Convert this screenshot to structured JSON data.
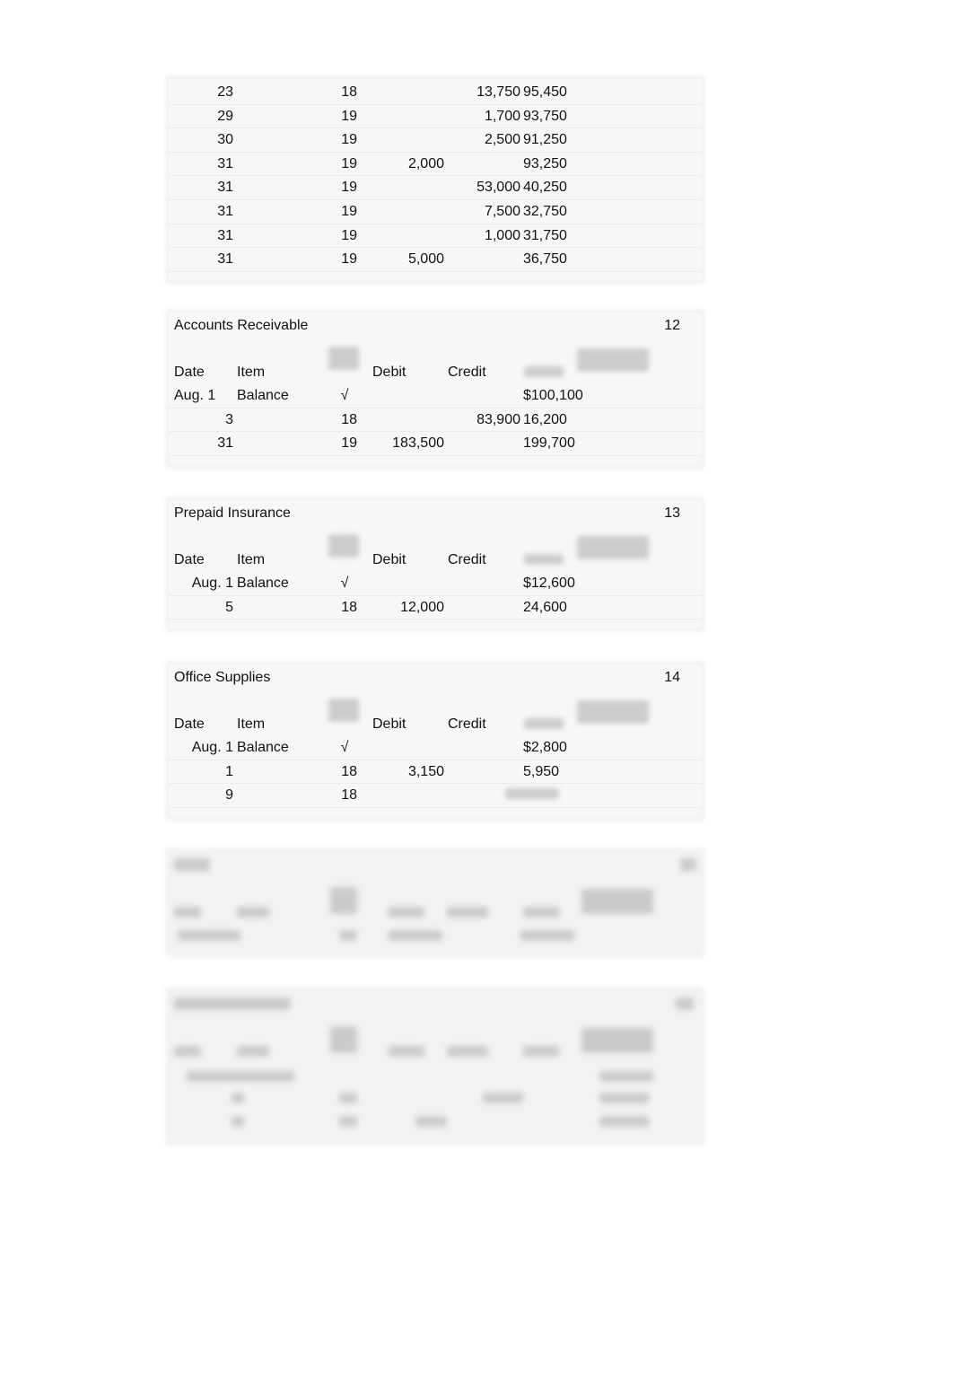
{
  "columns": {
    "date": "Date",
    "item": "Item",
    "debit": "Debit",
    "credit": "Credit"
  },
  "ledgers": [
    {
      "title": "",
      "number": "",
      "rows": [
        {
          "date": "23",
          "item": "",
          "ref": "18",
          "debit": "",
          "credit": "13,750",
          "balance": "95,450"
        },
        {
          "date": "29",
          "item": "",
          "ref": "19",
          "debit": "",
          "credit": "1,700",
          "balance": "93,750"
        },
        {
          "date": "30",
          "item": "",
          "ref": "19",
          "debit": "",
          "credit": "2,500",
          "balance": "91,250"
        },
        {
          "date": "31",
          "item": "",
          "ref": "19",
          "debit": "2,000",
          "credit": "",
          "balance": "93,250"
        },
        {
          "date": "31",
          "item": "",
          "ref": "19",
          "debit": "",
          "credit": "53,000",
          "balance": "40,250"
        },
        {
          "date": "31",
          "item": "",
          "ref": "19",
          "debit": "",
          "credit": "7,500",
          "balance": "32,750"
        },
        {
          "date": "31",
          "item": "",
          "ref": "19",
          "debit": "",
          "credit": "1,000",
          "balance": "31,750"
        },
        {
          "date": "31",
          "item": "",
          "ref": "19",
          "debit": "5,000",
          "credit": "",
          "balance": "36,750"
        }
      ]
    },
    {
      "title": "Accounts Receivable",
      "number": "12",
      "rows": [
        {
          "date": "Aug. 1",
          "item": "Balance",
          "ref": "√",
          "debit": "",
          "credit": "",
          "balance": "$100,100"
        },
        {
          "date": "3",
          "item": "",
          "ref": "18",
          "debit": "",
          "credit": "83,900",
          "balance": "16,200"
        },
        {
          "date": "31",
          "item": "",
          "ref": "19",
          "debit": "183,500",
          "credit": "",
          "balance": "199,700"
        }
      ]
    },
    {
      "title": "Prepaid Insurance",
      "number": "13",
      "rows": [
        {
          "date": "Aug. 1",
          "item": "Balance",
          "ref": "√",
          "debit": "",
          "credit": "",
          "balance": "$12,600"
        },
        {
          "date": "5",
          "item": "",
          "ref": "18",
          "debit": "12,000",
          "credit": "",
          "balance": "24,600"
        }
      ]
    },
    {
      "title": "Office Supplies",
      "number": "14",
      "rows": [
        {
          "date": "Aug. 1",
          "item": "Balance",
          "ref": "√",
          "debit": "",
          "credit": "",
          "balance": "$2,800"
        },
        {
          "date": "1",
          "item": "",
          "ref": "18",
          "debit": "3,150",
          "credit": "",
          "balance": "5,950"
        },
        {
          "date": "9",
          "item": "",
          "ref": "18",
          "debit": "",
          "credit": "",
          "balance": ""
        }
      ]
    }
  ]
}
